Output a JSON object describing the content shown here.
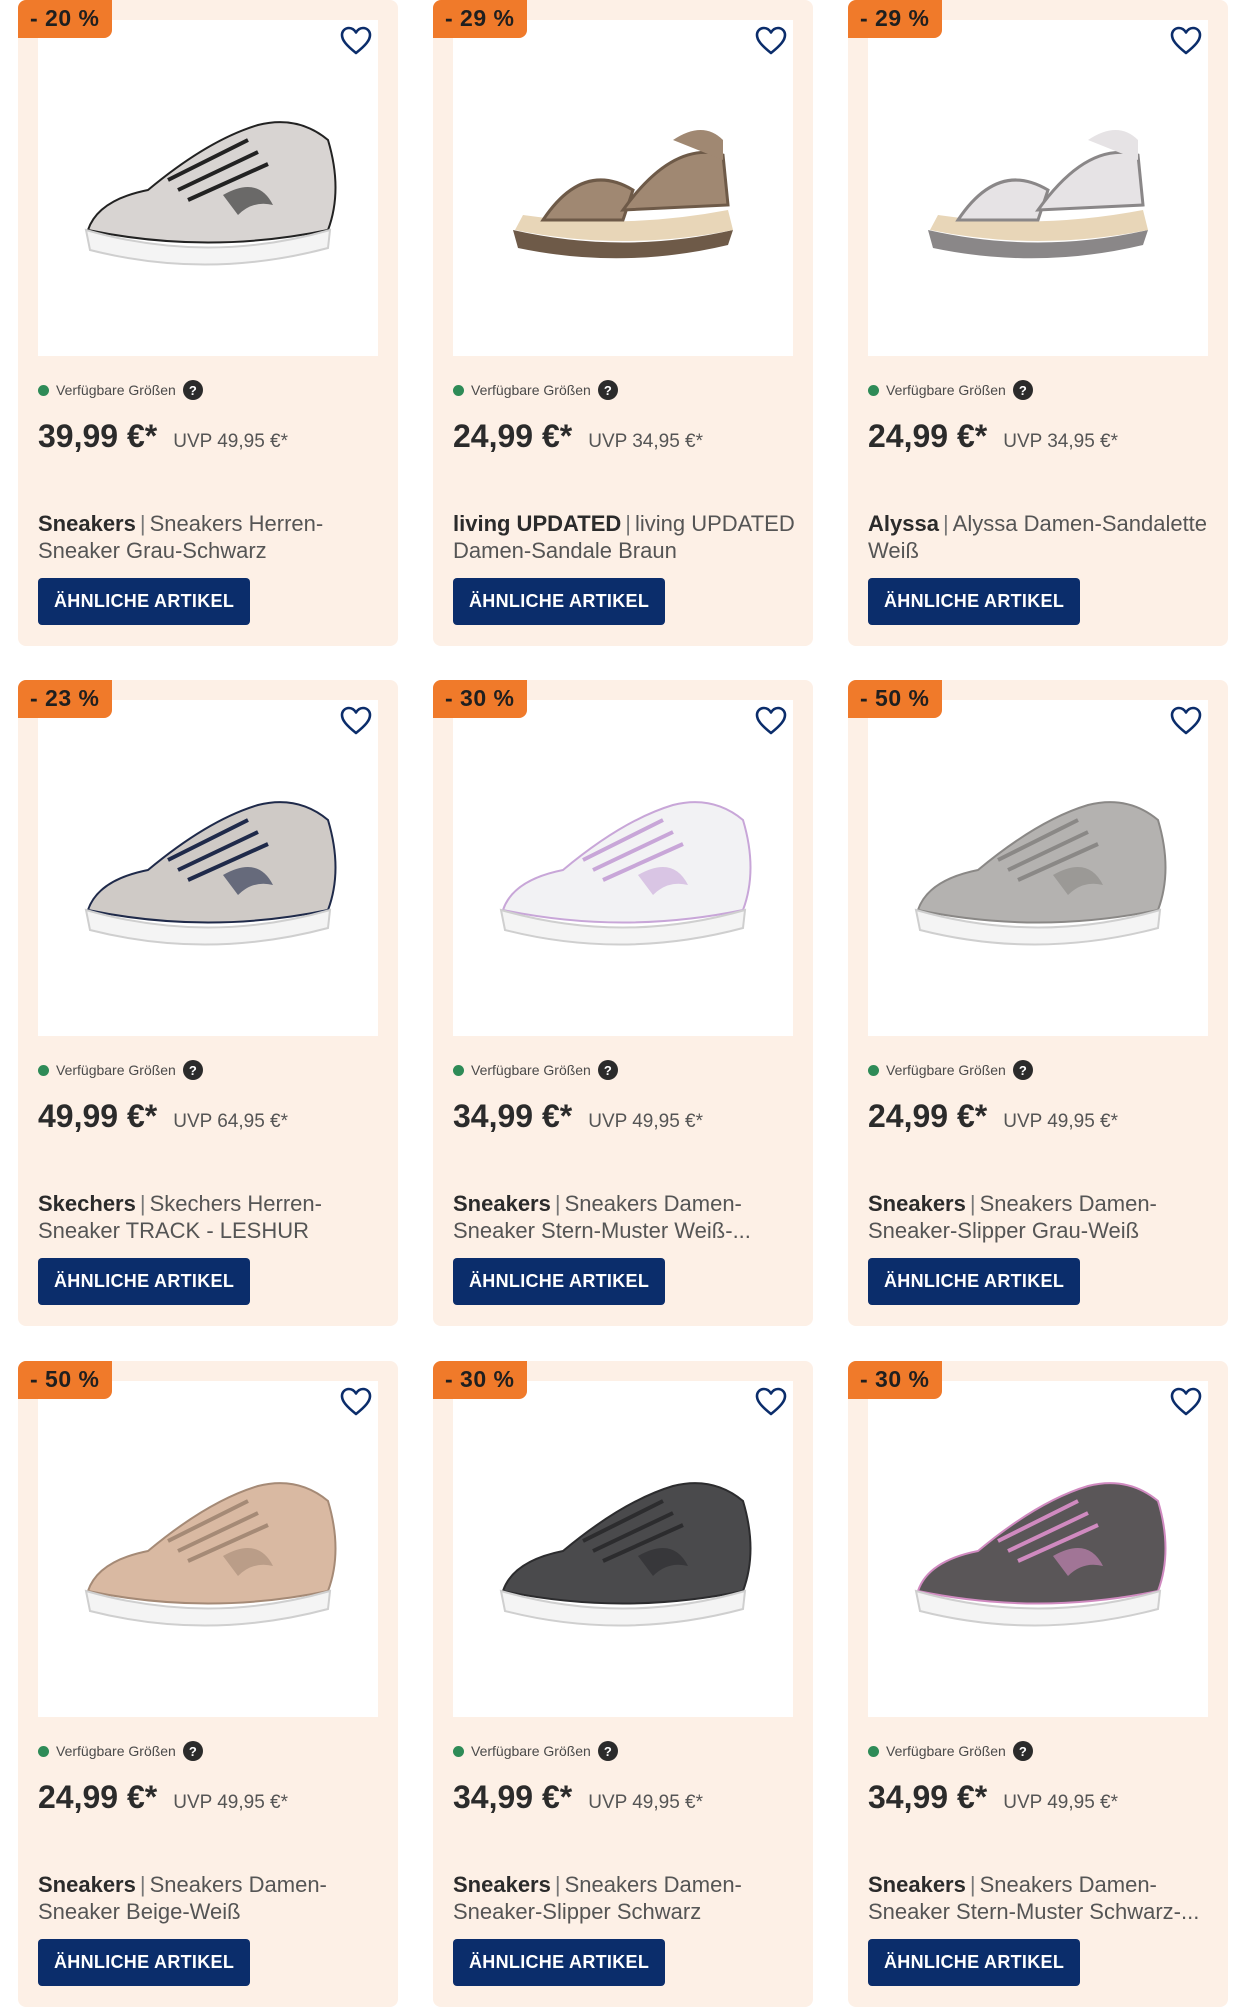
{
  "theme": {
    "card_bg": "#fdf0e6",
    "badge_color": "#f07a2a",
    "button_color": "#0b2d6b",
    "availability_dot": "#2e8b57"
  },
  "labels": {
    "sizes": "Verfügbare Größen",
    "help": "?",
    "similar": "ÄHNLICHE ARTIKEL",
    "separator": "|"
  },
  "products": [
    {
      "discount": "- 20 %",
      "price": "39,99 €*",
      "uvp": "UVP 49,95 €*",
      "brand": "Sneakers",
      "name": "Sneakers Herren-Sneaker Grau-Schwarz",
      "image": "grey-black-sneaker",
      "color": "#d8d4d2",
      "accent": "#222222"
    },
    {
      "discount": "- 29 %",
      "price": "24,99 €*",
      "uvp": "UVP 34,95 €*",
      "brand": "living UPDATED",
      "name": "living UPDATED Damen-Sandale Braun",
      "image": "brown-sandal",
      "color": "#a08872",
      "accent": "#6e5a48"
    },
    {
      "discount": "- 29 %",
      "price": "24,99 €*",
      "uvp": "UVP 34,95 €*",
      "brand": "Alyssa",
      "name": "Alyssa Damen-Sandalette Weiß",
      "image": "white-sandal",
      "color": "#e6e3e5",
      "accent": "#8a8788"
    },
    {
      "discount": "- 23 %",
      "price": "49,99 €*",
      "uvp": "UVP 64,95 €*",
      "brand": "Skechers",
      "name": "Skechers Herren-Sneaker TRACK - LESHUR Taupe...",
      "image": "taupe-sneaker",
      "color": "#cfcac6",
      "accent": "#1f2a4a"
    },
    {
      "discount": "- 30 %",
      "price": "34,99 €*",
      "uvp": "UVP 49,95 €*",
      "brand": "Sneakers",
      "name": "Sneakers Damen-Sneaker Stern-Muster Weiß-...",
      "image": "white-star-sneaker",
      "color": "#f2f2f4",
      "accent": "#c8a6d8"
    },
    {
      "discount": "- 50 %",
      "price": "24,99 €*",
      "uvp": "UVP 49,95 €*",
      "brand": "Sneakers",
      "name": "Sneakers Damen-Sneaker-Slipper Grau-Weiß",
      "image": "grey-slipper",
      "color": "#b4b2b0",
      "accent": "#8a8886"
    },
    {
      "discount": "- 50 %",
      "price": "24,99 €*",
      "uvp": "UVP 49,95 €*",
      "brand": "Sneakers",
      "name": "Sneakers Damen-Sneaker Beige-Weiß",
      "image": "beige-sneaker",
      "color": "#d9b9a2",
      "accent": "#a58a76"
    },
    {
      "discount": "- 30 %",
      "price": "34,99 €*",
      "uvp": "UVP 49,95 €*",
      "brand": "Sneakers",
      "name": "Sneakers Damen-Sneaker-Slipper Schwarz",
      "image": "black-slipper",
      "color": "#4a4a4c",
      "accent": "#2c2c2e"
    },
    {
      "discount": "- 30 %",
      "price": "34,99 €*",
      "uvp": "UVP 49,95 €*",
      "brand": "Sneakers",
      "name": "Sneakers Damen-Sneaker Stern-Muster Schwarz-...",
      "image": "black-star-sneaker",
      "color": "#5a5658",
      "accent": "#d08ac0"
    }
  ]
}
